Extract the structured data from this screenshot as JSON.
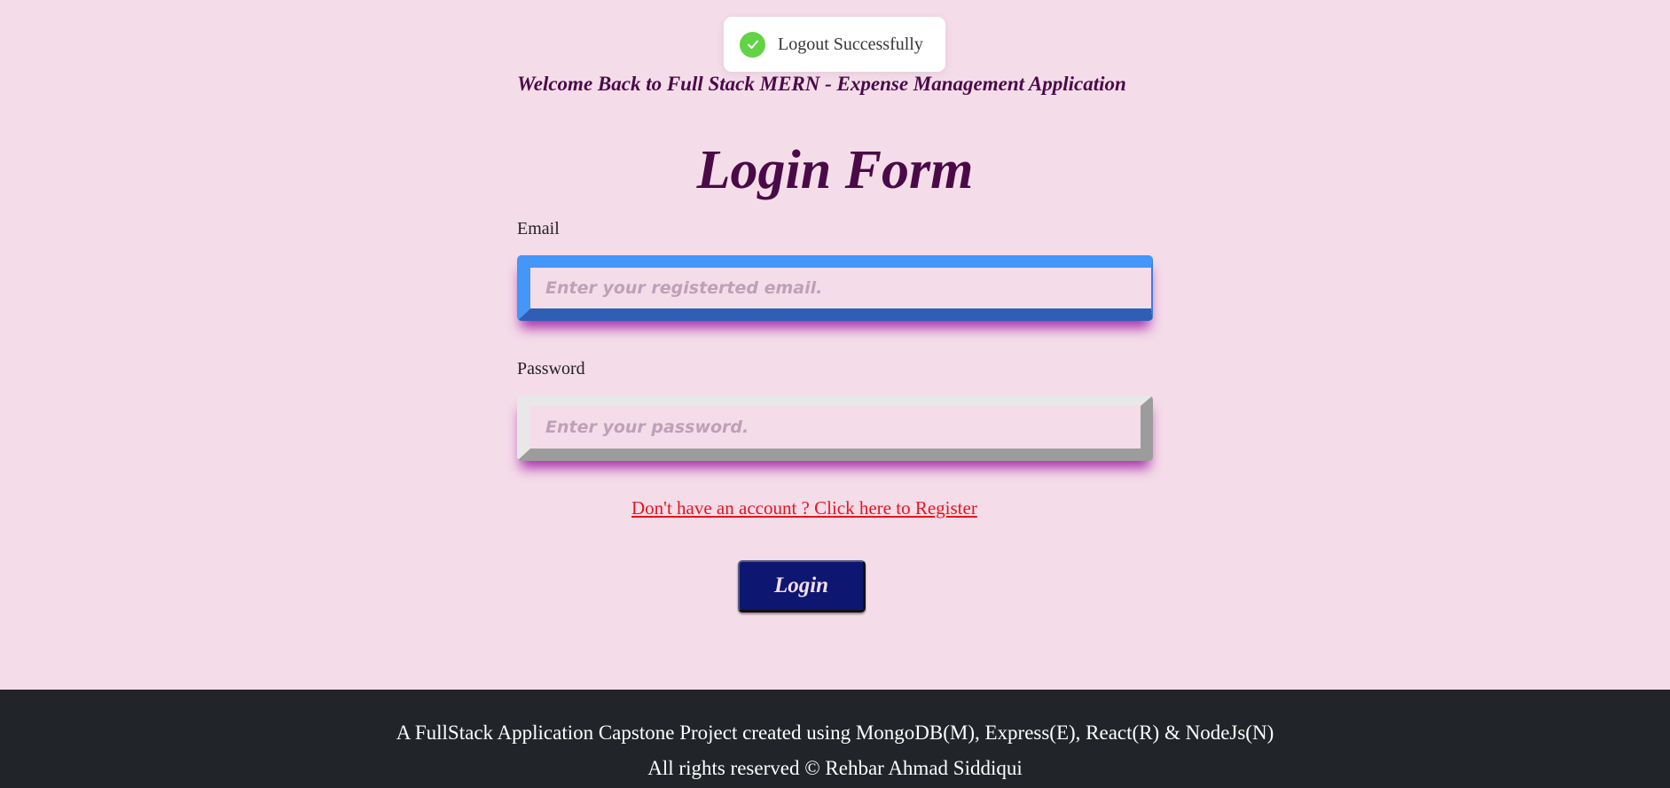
{
  "toast": {
    "message": "Logout Successfully",
    "icon": "check-circle-icon",
    "icon_color": "#61d345"
  },
  "welcome_text": "Welcome Back to Full Stack MERN - Expense Management Application",
  "form": {
    "title": "Login Form",
    "email_label": "Email",
    "email_placeholder": "Enter your registerted email.",
    "email_value": "",
    "password_label": "Password",
    "password_placeholder": "Enter your password.",
    "password_value": "",
    "register_link": "Don't have an account ? Click here to Register",
    "login_button": "Login"
  },
  "footer": {
    "line1": "A FullStack Application Capstone Project created using MongoDB(M), Express(E), React(R) & NodeJs(N)",
    "line2": "All rights reserved © Rehbar Ahmad Siddiqui"
  },
  "colors": {
    "background": "#f5dce9",
    "heading": "#4a0a47",
    "link": "#e8141c",
    "button": "#0d1670",
    "footer": "#212529"
  }
}
